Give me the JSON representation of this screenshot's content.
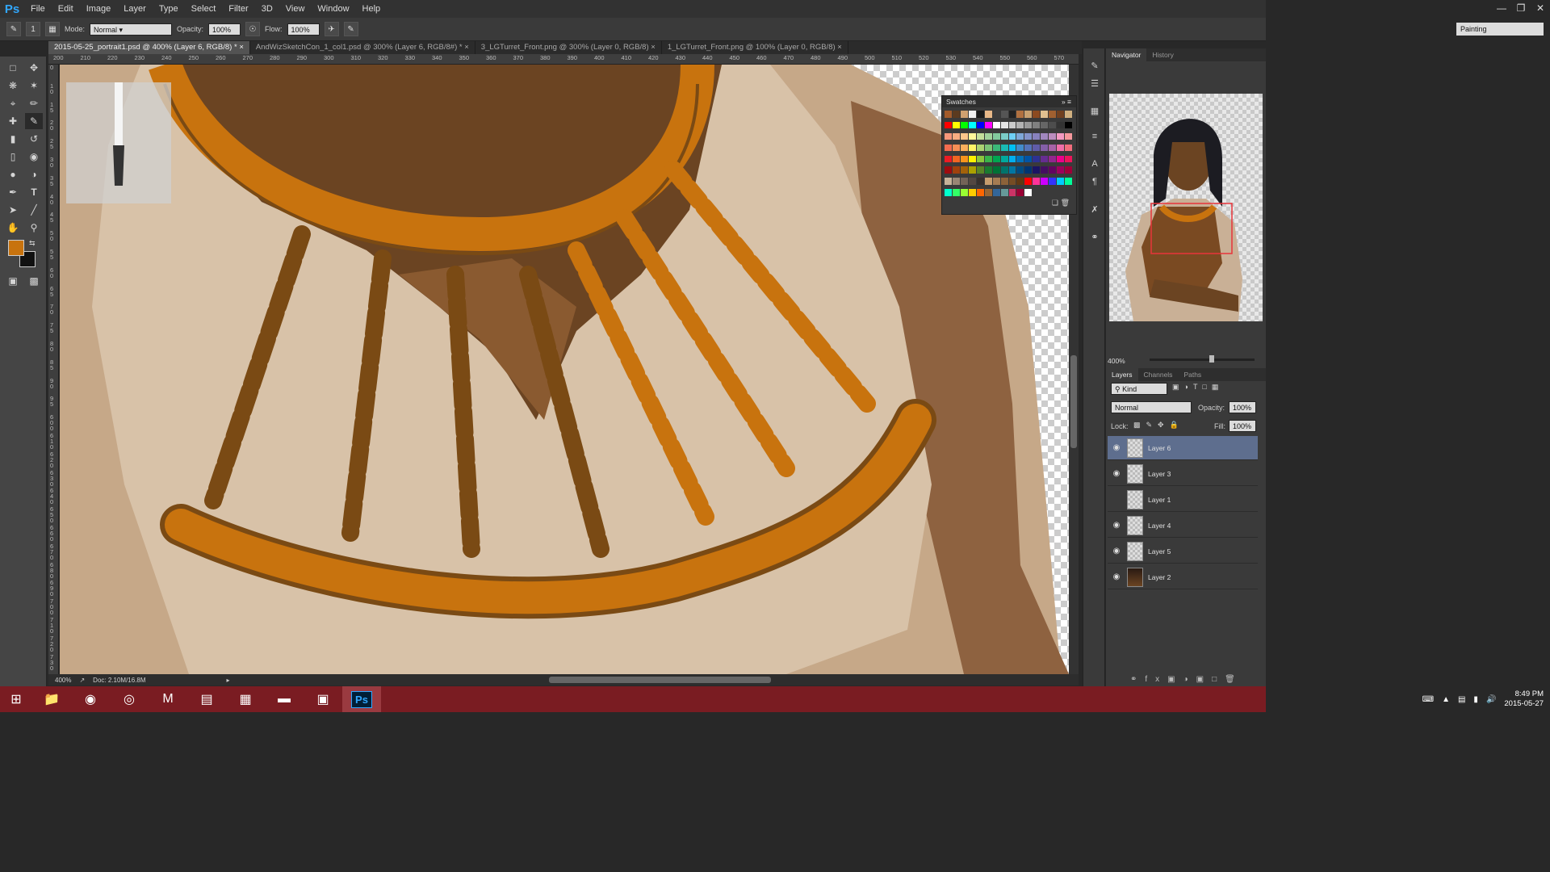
{
  "menubar": {
    "logo": "Ps",
    "items": [
      "File",
      "Edit",
      "Image",
      "Layer",
      "Type",
      "Select",
      "Filter",
      "3D",
      "View",
      "Window",
      "Help"
    ],
    "window_controls": [
      "minimize-icon",
      "restore-icon",
      "close-icon"
    ]
  },
  "options": {
    "brush_size": "1",
    "mode_label": "Mode:",
    "mode_value": "Normal",
    "opacity_label": "Opacity:",
    "opacity_value": "100%",
    "flow_label": "Flow:",
    "flow_value": "100%",
    "workspace": "Painting"
  },
  "tabs": [
    {
      "label": "2015-05-25_portrait1.psd @ 400% (Layer 6, RGB/8) *",
      "active": true
    },
    {
      "label": "AndWizSketchCon_1_col1.psd @ 300% (Layer 6, RGB/8#) *",
      "active": false
    },
    {
      "label": "3_LGTurret_Front.png @ 300% (Layer 0, RGB/8)",
      "active": false
    },
    {
      "label": "1_LGTurret_Front.png @ 100% (Layer 0, RGB/8)",
      "active": false
    }
  ],
  "ruler": {
    "top_ticks": [
      "200",
      "210",
      "220",
      "230",
      "240",
      "250",
      "260",
      "270",
      "280",
      "290",
      "300",
      "310",
      "320",
      "330",
      "340",
      "350",
      "360",
      "370",
      "380",
      "390",
      "400",
      "410",
      "420",
      "430",
      "440",
      "450",
      "460",
      "470",
      "480",
      "490",
      "500",
      "510",
      "520",
      "530",
      "540",
      "550",
      "560",
      "570"
    ],
    "left_ticks": [
      "0",
      "1 0",
      "1 5",
      "2 0",
      "2 5",
      "3 0",
      "3 5",
      "4 0",
      "4 5",
      "5 0",
      "5 5",
      "6 0",
      "6 5",
      "7 0",
      "7 5",
      "8 0",
      "8 5",
      "9 0",
      "9 5",
      "6 0 0",
      "6 1 0",
      "6 2 0",
      "6 3 0",
      "6 4 0",
      "6 5 0",
      "6 6 0",
      "6 7 0",
      "6 8 0",
      "6 9 0",
      "7 0 0",
      "7 1 0",
      "7 2 0",
      "7 3 0"
    ]
  },
  "colors": {
    "foreground": "#c8730e",
    "background": "#111111",
    "gold": "#c8730e",
    "gold_dark": "#7a4a14",
    "skin": "#6b4422",
    "cloth": "#d8c2a8",
    "selected_layer": "#5e6e8e",
    "taskbar": "#7a1c22"
  },
  "status": {
    "zoom": "400%",
    "doc": "Doc: 2.10M/16.8M"
  },
  "swatches": {
    "title": "Swatches",
    "colors": [
      "#a35b2b",
      "#5b3a1f",
      "#d0a070",
      "#f0f0f0",
      "#1a1a1a",
      "#e8b888",
      "#3c3c3c",
      "#555555",
      "#222222",
      "#b07040",
      "#c8a070",
      "#8c4a20",
      "#e0c090",
      "#a06030",
      "#704020",
      "#d0b080",
      "#ff0000",
      "#ffff00",
      "#00ff00",
      "#00ffff",
      "#0000ff",
      "#ff00ff",
      "#ffffff",
      "#e6e6e6",
      "#cccccc",
      "#b3b3b3",
      "#999999",
      "#808080",
      "#666666",
      "#4d4d4d",
      "#333333",
      "#000000",
      "#f7977a",
      "#f9ad81",
      "#fdc68a",
      "#fff79a",
      "#c4df9b",
      "#a2d39c",
      "#82ca9d",
      "#7bcdc8",
      "#6ecff6",
      "#7ea7d8",
      "#8493ca",
      "#8882be",
      "#a187be",
      "#bc8dbf",
      "#f49ac2",
      "#f6989d",
      "#f26c4f",
      "#f68e55",
      "#fbaf5c",
      "#fff467",
      "#acd372",
      "#7cc576",
      "#3bb878",
      "#1abbb4",
      "#00bff3",
      "#438cca",
      "#5574b9",
      "#605ca8",
      "#855fa8",
      "#a763a8",
      "#f06ea9",
      "#f26d7d",
      "#ed1c24",
      "#f26522",
      "#f7941d",
      "#fff200",
      "#8dc73f",
      "#39b54a",
      "#00a651",
      "#00a99d",
      "#00aeef",
      "#0072bc",
      "#0054a6",
      "#2e3192",
      "#662d91",
      "#92278f",
      "#ec008c",
      "#ed145b",
      "#9e0b0f",
      "#a0410d",
      "#a3620a",
      "#aba000",
      "#598527",
      "#1a7b30",
      "#007236",
      "#00746b",
      "#0076a3",
      "#004b80",
      "#003471",
      "#1b1464",
      "#440e62",
      "#630460",
      "#9e005d",
      "#9e0039",
      "#c7b299",
      "#998675",
      "#736357",
      "#534741",
      "#37302d",
      "#c69c6d",
      "#a67c52",
      "#8c6239",
      "#754c24",
      "#603913",
      "#ff0000",
      "#ff3399",
      "#cc00ff",
      "#3333ff",
      "#00ccff",
      "#00ff99",
      "#00ffcc",
      "#33ff66",
      "#99ff33",
      "#ffcc00",
      "#ff6600",
      "#996633",
      "#336699",
      "#669999",
      "#cc3366",
      "#990033",
      "#ffffff",
      "#3a3a3a",
      "#3a3a3a",
      "#3a3a3a",
      "#3a3a3a",
      "#3a3a3a"
    ]
  },
  "panels": {
    "nav_tabs": [
      "Navigator",
      "History"
    ],
    "nav_zoom": "400%",
    "layer_tabs": [
      "Layers",
      "Channels",
      "Paths"
    ],
    "filter_kind": "Kind",
    "blend_mode": "Normal",
    "opacity_label": "Opacity:",
    "opacity_value": "100%",
    "lock_label": "Lock:",
    "fill_label": "Fill:",
    "fill_value": "100%",
    "layers": [
      {
        "name": "Layer 6",
        "visible": true,
        "selected": true
      },
      {
        "name": "Layer 3",
        "visible": true,
        "selected": false
      },
      {
        "name": "Layer 1",
        "visible": false,
        "selected": false
      },
      {
        "name": "Layer 4",
        "visible": true,
        "selected": false
      },
      {
        "name": "Layer 5",
        "visible": true,
        "selected": false
      },
      {
        "name": "Layer 2",
        "visible": true,
        "selected": false
      }
    ]
  },
  "taskbar": {
    "apps": [
      "windows-start-icon",
      "file-explorer-icon",
      "media-player-icon",
      "chrome-icon",
      "malwarebytes-icon",
      "control-panel-icon",
      "calculator-icon",
      "tablet-pen-icon",
      "remote-desktop-icon",
      "photoshop-icon"
    ],
    "photoshop_label": "Ps",
    "time": "8:49 PM",
    "date": "2015-05-27"
  }
}
